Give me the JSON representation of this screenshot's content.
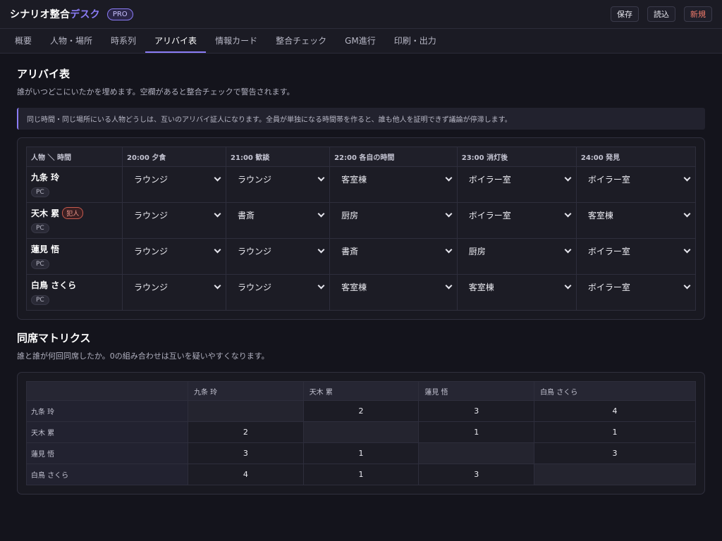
{
  "app": {
    "title_main": "シナリオ整合",
    "title_accent": "デスク",
    "badge": "PRO",
    "actions": {
      "save": "保存",
      "load": "読込",
      "new": "新規"
    }
  },
  "tabs": [
    {
      "label": "概要",
      "active": false
    },
    {
      "label": "人物・場所",
      "active": false
    },
    {
      "label": "時系列",
      "active": false
    },
    {
      "label": "アリバイ表",
      "active": true
    },
    {
      "label": "情報カード",
      "active": false
    },
    {
      "label": "整合チェック",
      "active": false
    },
    {
      "label": "GM進行",
      "active": false
    },
    {
      "label": "印刷・出力",
      "active": false
    }
  ],
  "alibi": {
    "title": "アリバイ表",
    "subtitle": "誰がいつどこにいたかを埋めます。空欄があると整合チェックで警告されます。",
    "note": "同じ時間・同じ場所にいる人物どうしは、互いのアリバイ証人になります。全員が単独になる時間帯を作ると、誰も他人を証明できず議論が停滞します。",
    "corner_header": "人物 ＼ 時間",
    "time_headers": [
      "20:00 夕食",
      "21:00 歓談",
      "22:00 各自の時間",
      "23:00 消灯後",
      "24:00 発見"
    ],
    "rows": [
      {
        "name": "九条 玲",
        "role": "PC",
        "culprit_badge": "",
        "locations": [
          "ラウンジ",
          "ラウンジ",
          "客室棟",
          "ボイラー室",
          "ボイラー室"
        ]
      },
      {
        "name": "天木 累",
        "role": "PC",
        "culprit_badge": "犯人",
        "locations": [
          "ラウンジ",
          "書斎",
          "厨房",
          "ボイラー室",
          "客室棟"
        ]
      },
      {
        "name": "蓮見 悟",
        "role": "PC",
        "culprit_badge": "",
        "locations": [
          "ラウンジ",
          "ラウンジ",
          "書斎",
          "厨房",
          "ボイラー室"
        ]
      },
      {
        "name": "白鳥 さくら",
        "role": "PC",
        "culprit_badge": "",
        "locations": [
          "ラウンジ",
          "ラウンジ",
          "客室棟",
          "客室棟",
          "ボイラー室"
        ]
      }
    ]
  },
  "matrix": {
    "title": "同席マトリクス",
    "subtitle": "誰と誰が何回同席したか。0の組み合わせは互いを疑いやすくなります。",
    "headers": [
      "九条 玲",
      "天木 累",
      "蓮見 悟",
      "白鳥 さくら"
    ],
    "rows": [
      {
        "name": "九条 玲",
        "values": [
          "",
          "2",
          "3",
          "4"
        ]
      },
      {
        "name": "天木 累",
        "values": [
          "2",
          "",
          "1",
          "1"
        ]
      },
      {
        "name": "蓮見 悟",
        "values": [
          "3",
          "1",
          "",
          "3"
        ]
      },
      {
        "name": "白鳥 さくら",
        "values": [
          "4",
          "1",
          "3",
          ""
        ]
      }
    ]
  }
}
